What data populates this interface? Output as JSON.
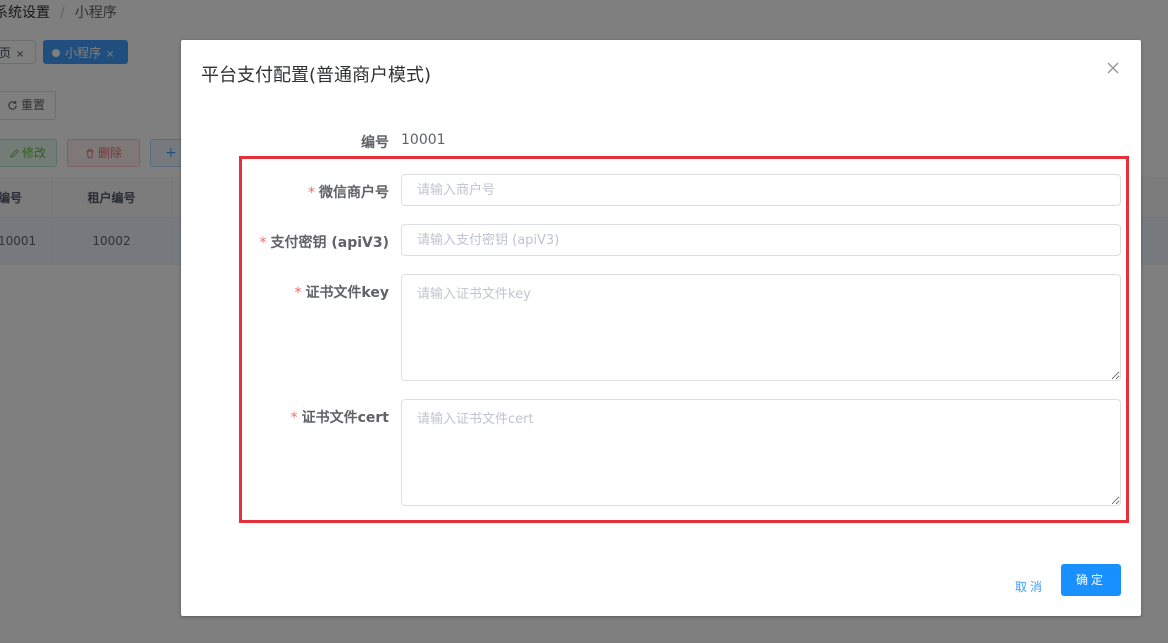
{
  "background": {
    "breadcrumb": [
      "系统设置",
      "/",
      "小程序"
    ],
    "tabs": [
      {
        "label": "页",
        "close": "×"
      },
      {
        "label": "小程序",
        "close": "×"
      }
    ],
    "reset_button": "重置",
    "edit_button": "修改",
    "delete_button": "删除",
    "add_button": "+",
    "table": {
      "headers": [
        "编号",
        "租户编号"
      ],
      "rows": [
        [
          "10001",
          "10002"
        ]
      ]
    }
  },
  "dialog": {
    "title": "平台支付配置(普通商户模式)",
    "close_icon": "close-icon",
    "id_label": "编号",
    "id_value": "10001",
    "fields": [
      {
        "required": "*",
        "label": "微信商户号",
        "placeholder": "请输入商户号",
        "value": ""
      },
      {
        "required": "*",
        "label": "支付密钥 (apiV3)",
        "placeholder": "请输入支付密钥 (apiV3)",
        "value": ""
      },
      {
        "required": "*",
        "label": "证书文件key",
        "placeholder": "请输入证书文件key",
        "value": ""
      },
      {
        "required": "*",
        "label": "证书文件cert",
        "placeholder": "请输入证书文件cert",
        "value": ""
      }
    ],
    "cancel_button": "取消",
    "confirm_button": "确定",
    "highlight_color": "#e5303a"
  },
  "colors": {
    "primary": "#1890ff",
    "link": "#409eff",
    "required": "#f56c6c",
    "mask": "rgba(0,0,0,0.5)"
  }
}
